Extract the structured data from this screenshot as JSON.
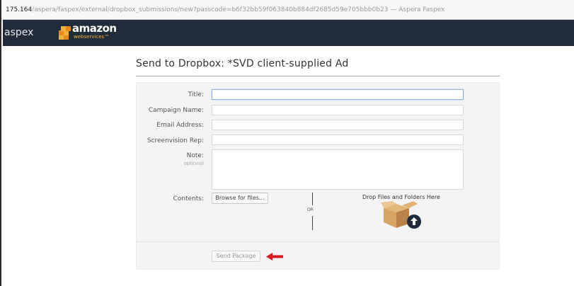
{
  "browser": {
    "host": "175.164",
    "url_path": "/aspera/faspex/external/dropbox_submissions/new?passcode=b6f32bb59f063840b884df2685d59e705bbb0b23",
    "title_suffix": " — Aspera Faspex"
  },
  "nav": {
    "brand": "aspex",
    "logo_word": "amazon",
    "logo_sub": "webservices™"
  },
  "page": {
    "heading": "Send to Dropbox: *SVD client-supplied Ad"
  },
  "form": {
    "title_label": "Title:",
    "title_value": "",
    "campaign_label": "Campaign Name:",
    "campaign_value": "",
    "email_label": "Email Address:",
    "email_value": "",
    "rep_label": "Screenvision Rep:",
    "rep_value": "",
    "note_label": "Note:",
    "note_optional": "optional",
    "note_value": "",
    "contents_label": "Contents:",
    "browse_label": "Browse for files...",
    "or_label": "OR",
    "drop_label": "Drop Files and Folders Here",
    "send_label": "Send Package"
  },
  "colors": {
    "nav_bg": "#212c3b",
    "accent_arrow": "#d9181f",
    "focus_border": "#8fb3dd"
  },
  "icons": {
    "logo": "aws-cubes-icon",
    "drop": "box-upload-icon",
    "pointer": "red-arrow-left-icon"
  }
}
